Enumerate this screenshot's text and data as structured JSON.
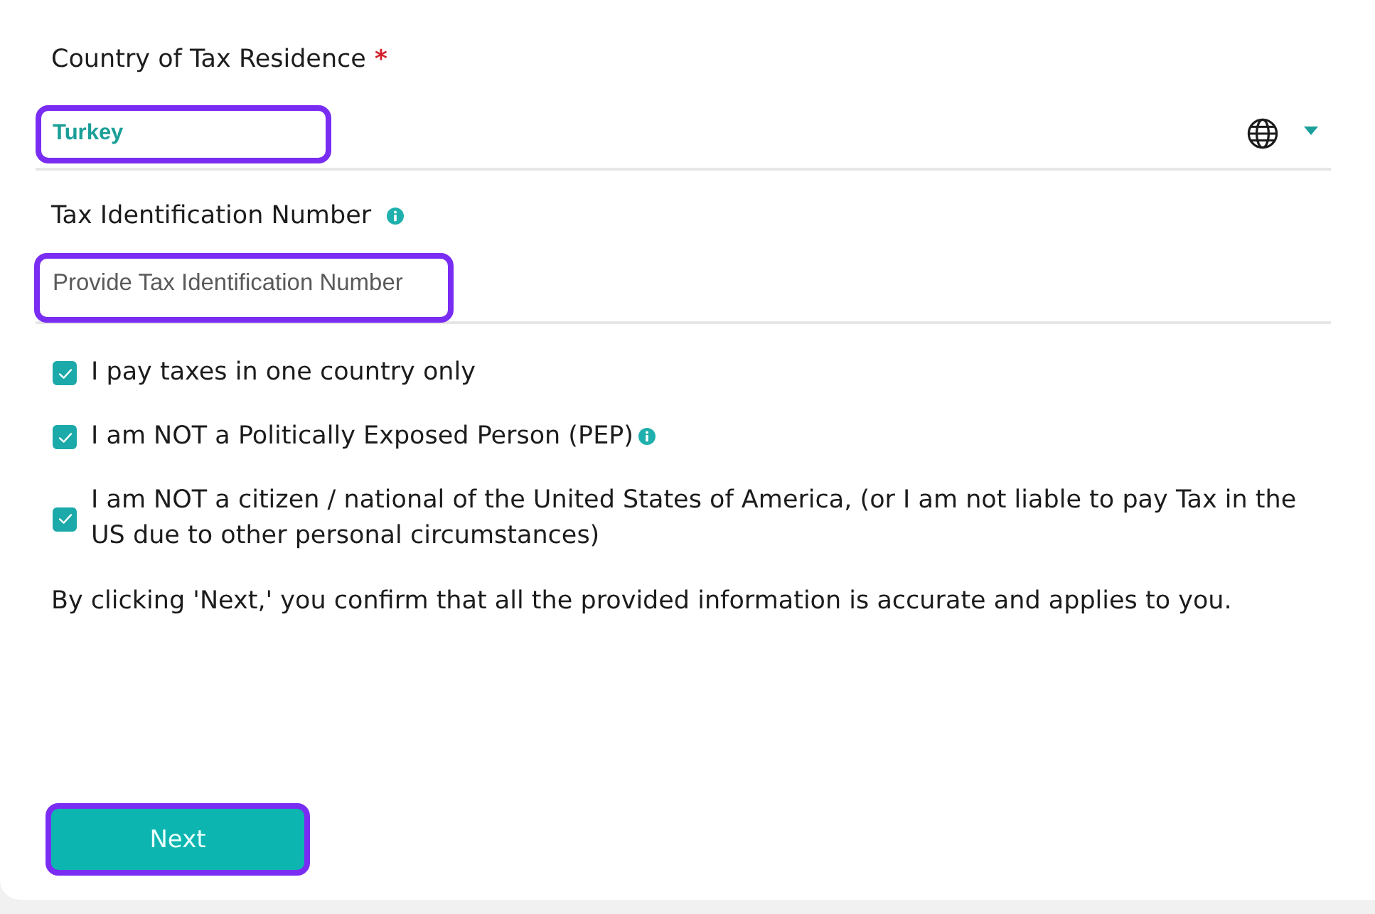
{
  "tax_residence": {
    "label": "Country of Tax Residence",
    "required_mark": "*",
    "value": "Turkey",
    "highlighted": true
  },
  "tax_id": {
    "label": "Tax Identification Number",
    "info": true,
    "placeholder": "Provide Tax Identification Number",
    "highlighted": true
  },
  "checkboxes": [
    {
      "label": "I pay taxes in one country only",
      "checked": true,
      "info": false
    },
    {
      "label": "I am NOT a Politically Exposed Person (PEP)",
      "checked": true,
      "info": true
    },
    {
      "label": "I am NOT a citizen / national of the United States of America, (or I am not liable to pay Tax in the US due to other personal circumstances)",
      "checked": true,
      "info": false
    }
  ],
  "notice": "By clicking 'Next,' you confirm that all the provided information is accurate and applies to you.",
  "next_button": {
    "label": "Next",
    "highlighted": true
  }
}
